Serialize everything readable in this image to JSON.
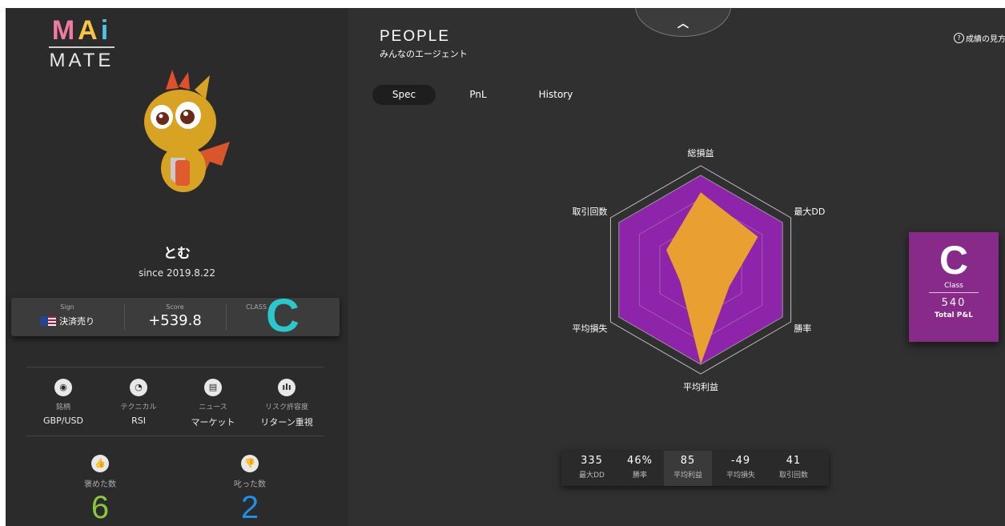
{
  "logo": {
    "mai": [
      "M",
      "A",
      "i"
    ],
    "mate": "MATE"
  },
  "profile": {
    "name": "とむ",
    "since": "since 2019.8.22"
  },
  "status": {
    "sign_label": "Sign",
    "sign_value": "決済売り",
    "score_label": "Score",
    "score_value": "+539.8",
    "class_label": "CLASS",
    "class_value": "C"
  },
  "config": [
    {
      "icon": "globe-icon",
      "glyph": "◉",
      "label": "銘柄",
      "value": "GBP/USD"
    },
    {
      "icon": "technical-icon",
      "glyph": "◔",
      "label": "テクニカル",
      "value": "RSI"
    },
    {
      "icon": "news-icon",
      "glyph": "▤",
      "label": "ニュース",
      "value": "マーケット"
    },
    {
      "icon": "risk-chart-icon",
      "glyph": "ılı",
      "label": "リスク許容度",
      "value": "リターン重視"
    }
  ],
  "feedback": {
    "praised_label": "褒めた数",
    "praised_count": "6",
    "scolded_label": "叱った数",
    "scolded_count": "2"
  },
  "colors": {
    "praised": "#8cc63f",
    "scolded": "#1e90e8",
    "class_accent": "#2ac7cd",
    "radar_fill": "#8e24aa",
    "radar_shape": "#eaa030",
    "class_card": "#882a8a"
  },
  "header": {
    "title": "PEOPLE",
    "subtitle": "みんなのエージェント",
    "help": "成績の見方"
  },
  "tabs": [
    "Spec",
    "PnL",
    "History"
  ],
  "active_tab": "Spec",
  "chart_data": {
    "type": "radar",
    "axes": [
      "総損益",
      "最大DD",
      "勝率",
      "平均利益",
      "平均損失",
      "取引回数"
    ],
    "values": [
      0.82,
      0.7,
      0.35,
      1.0,
      0.25,
      0.42
    ],
    "max": 1.0,
    "rings": 4
  },
  "class_card": {
    "grade": "C",
    "grade_label": "Class",
    "pnl": "540",
    "pnl_label": "Total P&L"
  },
  "stats": [
    {
      "value": "335",
      "label": "最大DD"
    },
    {
      "value": "46%",
      "label": "勝率"
    },
    {
      "value": "85",
      "label": "平均利益"
    },
    {
      "value": "-49",
      "label": "平均損失"
    },
    {
      "value": "41",
      "label": "取引回数"
    }
  ]
}
